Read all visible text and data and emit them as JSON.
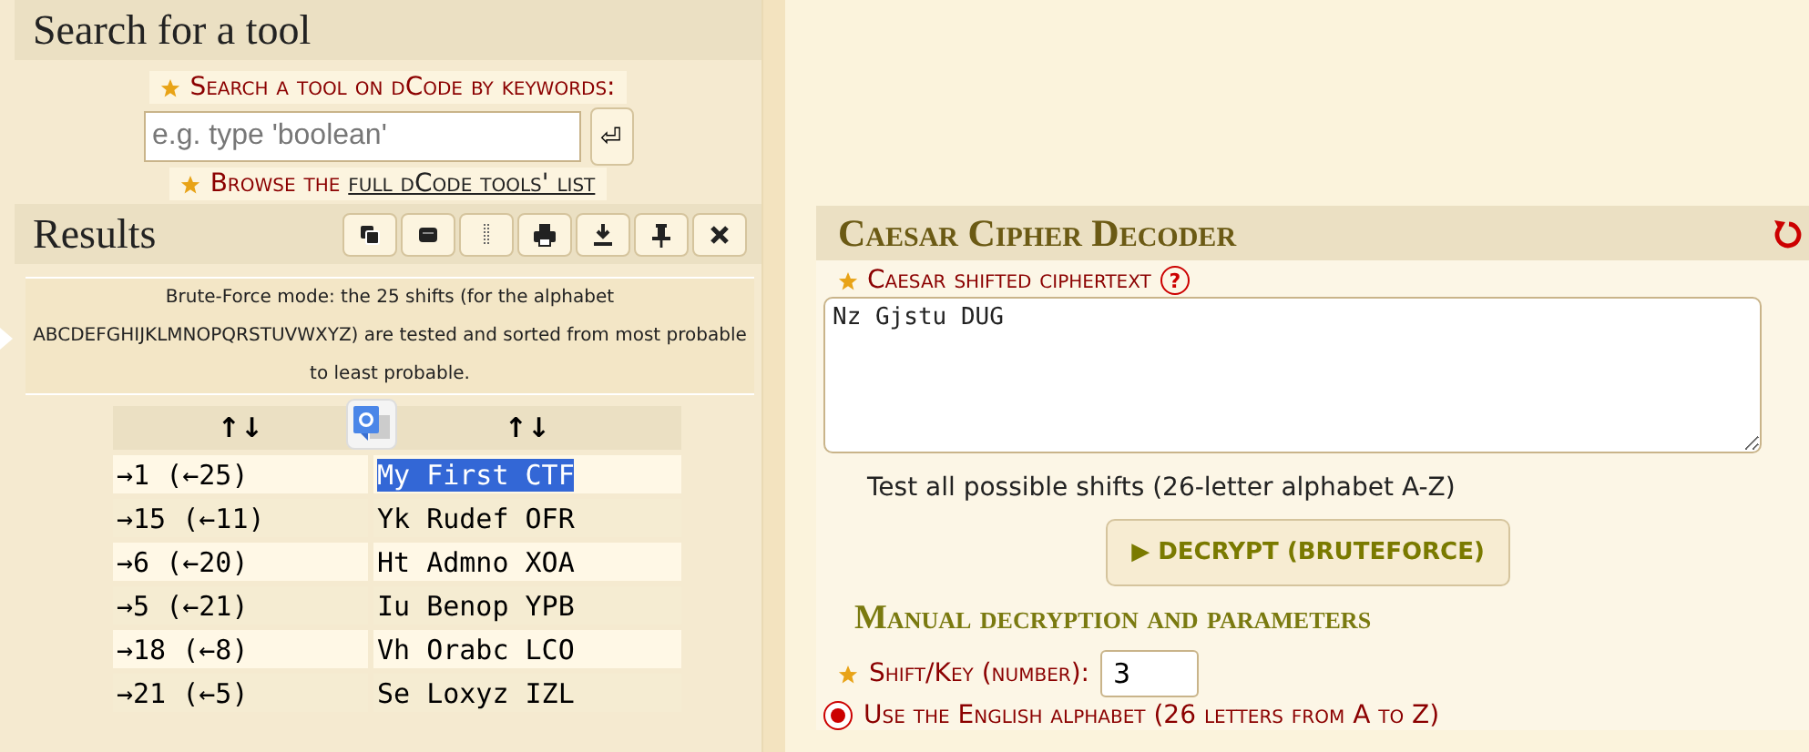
{
  "search_panel": {
    "title": "Search for a tool",
    "keyword_label": "Search a tool on dCode by keywords:",
    "search_field": {
      "placeholder": "e.g. type 'boolean'"
    },
    "enter_button": "⏎",
    "browse_text": "Browse the",
    "browse_link": "full dCode tools' list"
  },
  "results": {
    "title": "Results",
    "info": "Brute-Force mode: the 25 shifts (for the alphabet ABCDEFGHIJKLMNOPQRSTUVWXYZ) are tested and sorted from most probable to least probable.",
    "table": {
      "columns": [
        "↑↓",
        "↑↓"
      ],
      "rows": [
        {
          "shift": "→1 (←25)",
          "text": "My First CTF",
          "selected": true
        },
        {
          "shift": "→15 (←11)",
          "text": "Yk Rudef OFR",
          "selected": false
        },
        {
          "shift": "→6 (←20)",
          "text": "Ht Admno XOA",
          "selected": false
        },
        {
          "shift": "→5 (←21)",
          "text": "Iu Benop YPB",
          "selected": false
        },
        {
          "shift": "→18 (←8)",
          "text": "Vh Orabc LCO",
          "selected": false
        },
        {
          "shift": "→21 (←5)",
          "text": "Se Loxyz IZL",
          "selected": false
        }
      ]
    }
  },
  "decoder": {
    "title": "Caesar Cipher Decoder",
    "ciphertext_label": "Caesar shifted ciphertext",
    "help": "?",
    "ciphertext": "Nz Gjstu DUG",
    "bruteforce_hint": "Test all possible shifts (26-letter alphabet A-Z)",
    "decrypt_button": "▶ DECRYPT (BRUTEFORCE)",
    "manual_title": "Manual decryption and parameters",
    "shift_label": "Shift/Key (number):",
    "shift_value": "3",
    "alphabet_option": {
      "label": "Use the English alphabet (26 letters from A to Z)",
      "selected": true
    }
  }
}
